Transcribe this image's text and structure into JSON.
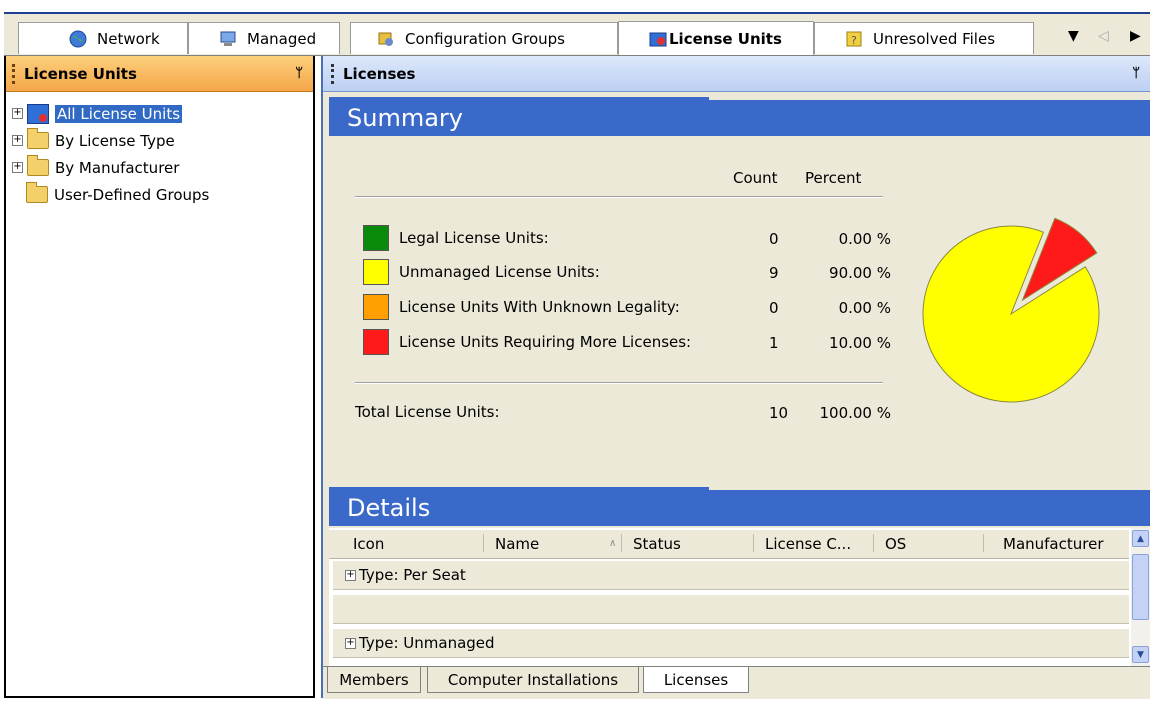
{
  "tabs": [
    {
      "label": "Network",
      "icon": "globe-icon"
    },
    {
      "label": "Managed",
      "icon": "computer-icon"
    },
    {
      "label": "Configuration Groups",
      "icon": "config-icon"
    },
    {
      "label": "License Units",
      "icon": "license-units-icon",
      "active": true
    },
    {
      "label": "Unresolved Files",
      "icon": "unresolved-icon"
    }
  ],
  "left_panel": {
    "title": "License Units",
    "tree": [
      {
        "label": "All License Units",
        "selected": true
      },
      {
        "label": "By License Type"
      },
      {
        "label": "By Manufacturer"
      },
      {
        "label": "User-Defined Groups"
      }
    ]
  },
  "right_panel": {
    "title": "Licenses",
    "summary": {
      "heading": "Summary",
      "col_count": "Count",
      "col_percent": "Percent",
      "rows": [
        {
          "label": "Legal License Units:",
          "count": "0",
          "percent": "0.00 %",
          "color": "#0a8a0a"
        },
        {
          "label": "Unmanaged License Units:",
          "count": "9",
          "percent": "90.00 %",
          "color": "#ffff00"
        },
        {
          "label": "License Units With Unknown Legality:",
          "count": "0",
          "percent": "0.00 %",
          "color": "#ffa000"
        },
        {
          "label": "License Units Requiring More Licenses:",
          "count": "1",
          "percent": "10.00 %",
          "color": "#ff1a1a"
        }
      ],
      "total_label": "Total License Units:",
      "total_count": "10",
      "total_percent": "100.00 %"
    },
    "details": {
      "heading": "Details",
      "columns": [
        "Icon",
        "Name",
        "Status",
        "License C...",
        "OS",
        "Manufacturer"
      ],
      "groups": [
        "Type: Per Seat",
        "Type: Unmanaged"
      ]
    },
    "bottom_tabs": [
      "Members",
      "Computer Installations",
      "Licenses"
    ]
  },
  "chart_data": {
    "type": "pie",
    "categories": [
      "Legal License Units",
      "Unmanaged License Units",
      "License Units With Unknown Legality",
      "License Units Requiring More Licenses"
    ],
    "values": [
      0,
      9,
      0,
      1
    ],
    "colors": [
      "#0a8a0a",
      "#ffff00",
      "#ffa000",
      "#ff1a1a"
    ]
  }
}
